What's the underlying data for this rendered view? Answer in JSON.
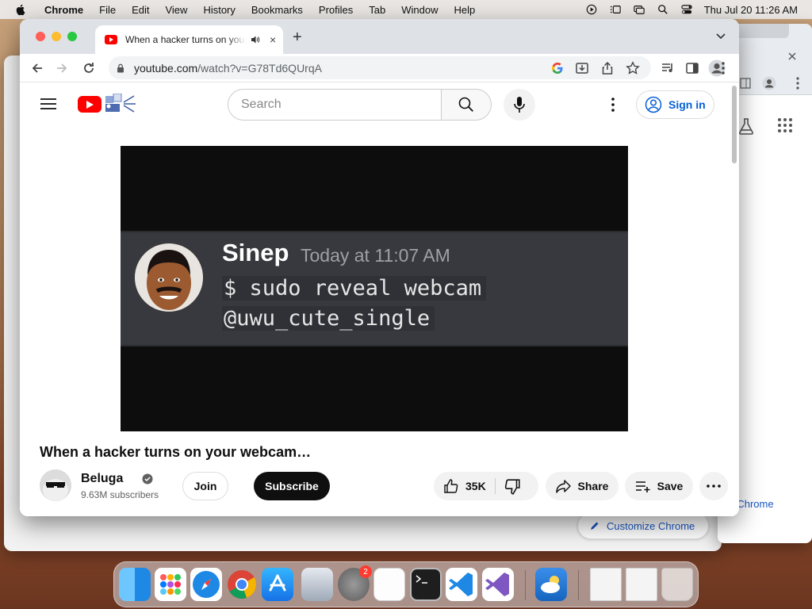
{
  "menubar": {
    "app": "Chrome",
    "items": [
      "File",
      "Edit",
      "View",
      "History",
      "Bookmarks",
      "Profiles",
      "Tab",
      "Window",
      "Help"
    ],
    "clock": "Thu Jul 20  11:26 AM"
  },
  "tab": {
    "title": "When a hacker turns on your webcam",
    "close": "×"
  },
  "newtab": "+",
  "omnibox": {
    "host": "youtube.com",
    "path": "/watch?v=G78Td6QUrqA"
  },
  "youtube": {
    "search_placeholder": "Search",
    "signin": "Sign in",
    "video": {
      "username": "Sinep",
      "time": "Today at 11:07 AM",
      "line1": "$ sudo reveal webcam",
      "line2": "@uwu_cute_single"
    },
    "title": "When a hacker turns on your webcam…",
    "channel": {
      "name": "Beluga",
      "subscribers": "9.63M subscribers"
    },
    "join": "Join",
    "subscribe": "Subscribe",
    "likes": "35K",
    "share": "Share",
    "save": "Save"
  },
  "background_window": {
    "customize": "Customize Chrome",
    "customize_partial": "ze Chrome"
  },
  "dock": {
    "settings_badge": "2"
  },
  "colors": {
    "youtube_red": "#ff0000",
    "link_blue": "#065fd4",
    "subscribe_bg": "#0f0f0f"
  }
}
